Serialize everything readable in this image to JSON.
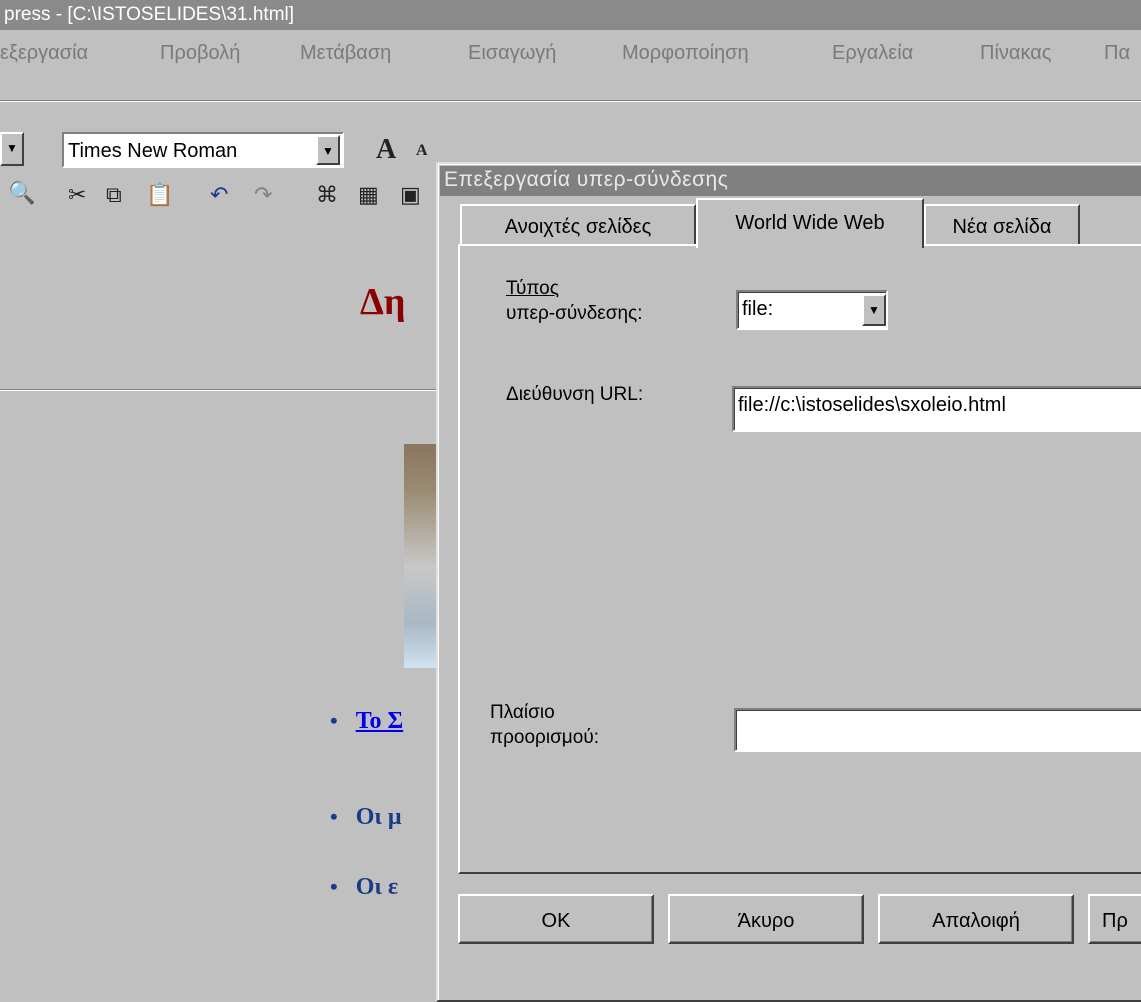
{
  "window": {
    "title": "press - [C:\\ISTOSELIDES\\31.html]"
  },
  "menubar": {
    "items": [
      "εξεργασία",
      "Προβολή",
      "Μετάβαση",
      "Εισαγωγή",
      "Μορφοποίηση",
      "Εργαλεία",
      "Πίνακας",
      "Πα"
    ]
  },
  "toolbar": {
    "font_name": "Times New Roman",
    "bigger_font": "A",
    "smaller_font": "A"
  },
  "document": {
    "heading": "Δη",
    "bullets": [
      {
        "text": "Το Σ",
        "link": true
      },
      {
        "text": "Οι μ",
        "link": false
      },
      {
        "text": "Οι ε",
        "link": false
      }
    ]
  },
  "dialog": {
    "title": "Επεξεργασία υπερ-σύνδεσης",
    "tabs": [
      "Ανοιχτές σελίδες",
      "World Wide Web",
      "Νέα σελίδα"
    ],
    "active_tab": 1,
    "hyperlink_type_label_1": "Τύπος",
    "hyperlink_type_label_2": "υπερ-σύνδεσης:",
    "hyperlink_type_value": "file:",
    "url_label": "Διεύθυνση URL:",
    "url_value": "file://c:\\istoselides\\sxoleio.html",
    "target_label_1": "Πλαίσιο",
    "target_label_2": "προορισμού:",
    "target_value": "",
    "buttons": {
      "ok": "OK",
      "cancel": "Άκυρο",
      "clear": "Απαλοιφή",
      "extra": "Πρ"
    }
  }
}
